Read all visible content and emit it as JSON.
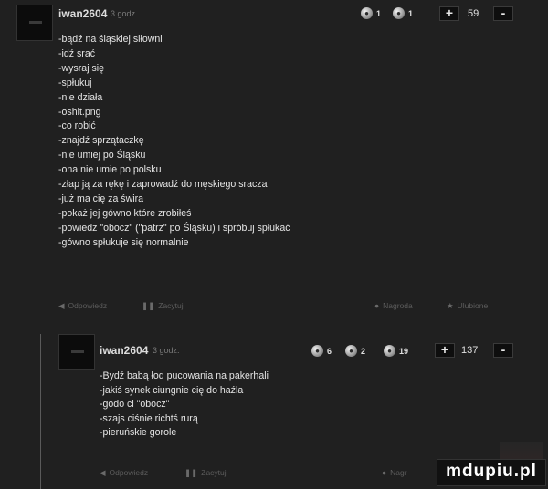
{
  "comment1": {
    "username": "iwan2604",
    "time": "3 godz.",
    "medals": [
      {
        "icon": "medal-1",
        "count": "1"
      },
      {
        "icon": "medal-2",
        "count": "1"
      }
    ],
    "score": "59",
    "lines": [
      "-bądź na śląskiej siłowni",
      "-idź srać",
      "-wysraj się",
      "-spłukuj",
      "-nie działa",
      "-oshit.png",
      "-co robić",
      "-znajdź sprzątaczkę",
      "-nie umiej po Śląsku",
      "-ona nie umie po polsku",
      "-złap ją za rękę i zaprowadź do męskiego sracza",
      "-już ma cię za świra",
      "-pokaż jej gówno które zrobiłeś",
      "-powiedz \"obocz\" (\"patrz\" po Śląsku) i spróbuj spłukać",
      "-gówno spłukuje się normalnie"
    ],
    "footer": {
      "reply": "Odpowiedz",
      "report": "Zacytuj",
      "award": "Nagroda",
      "favorite": "Ulubione"
    }
  },
  "comment2": {
    "username": "iwan2604",
    "time": "3 godz.",
    "medals": [
      {
        "icon": "medal-1",
        "count": "6"
      },
      {
        "icon": "medal-2",
        "count": "2"
      },
      {
        "icon": "medal-3",
        "count": "19"
      }
    ],
    "score": "137",
    "lines": [
      "-Bydź babą łod pucowania na pakerhali",
      "-jakiś synek ciungnie cię do haźla",
      "-godo ci \"obocz\"",
      "-szajs ciśnie richtś rurą",
      "-pieruńskie gorole"
    ],
    "footer": {
      "reply": "Odpowiedz",
      "report": "Zacytuj",
      "award": "Nagr"
    }
  },
  "vote": {
    "plus": "+",
    "minus": "-"
  },
  "watermark": "mdupiu.pl"
}
